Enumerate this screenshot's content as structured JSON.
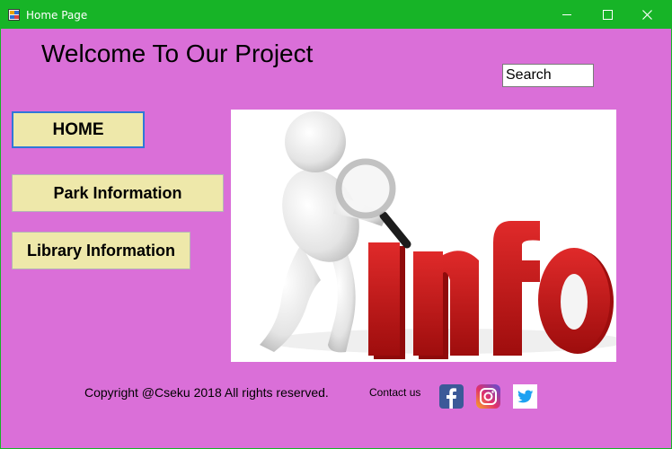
{
  "window": {
    "title": "Home Page",
    "accent": "#17b427",
    "background": "#da6fd8"
  },
  "header": {
    "welcome": "Welcome To Our Project"
  },
  "search": {
    "value": "Search"
  },
  "nav": {
    "home": "HOME",
    "park": "Park Information",
    "library": "Library Information",
    "button_color": "#eee8aa"
  },
  "hero": {
    "word": "Info"
  },
  "footer": {
    "copyright": "Copyright @Cseku 2018 All rights reserved.",
    "contact": "Contact us",
    "socials": [
      "facebook-icon",
      "instagram-icon",
      "twitter-icon"
    ]
  }
}
